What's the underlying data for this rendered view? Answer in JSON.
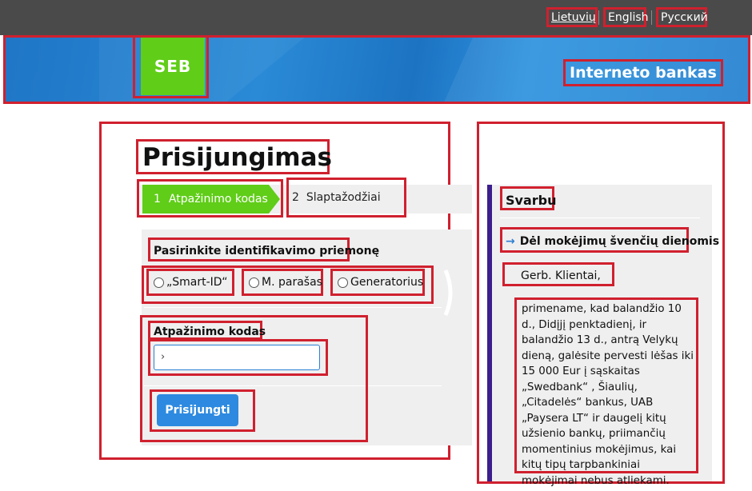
{
  "languages": [
    "Lietuvių",
    "English",
    "Русский"
  ],
  "brand": {
    "logo_text": "SEB",
    "logo_color": "#60cd18",
    "banner_title": "Interneto bankas"
  },
  "login": {
    "title": "Prisijungimas",
    "steps": [
      {
        "number": "1",
        "label": "Atpažinimo kodas",
        "active": true
      },
      {
        "number": "2",
        "label": "Slaptažodžiai",
        "active": false
      }
    ],
    "method_label": "Pasirinkite identifikavimo priemonę",
    "methods": [
      "„Smart-ID“",
      "M. parašas",
      "Generatorius"
    ],
    "code_label": "Atpažinimo kodas",
    "code_value": "›",
    "submit_label": "Prisijungti"
  },
  "notice": {
    "title": "Svarbu",
    "link": "Dėl mokėjimų švenčių dienomis",
    "greeting": "Gerb. Klientai,",
    "body": "primename, kad balandžio 10 d., Didįjį penktadienį, ir balandžio 13 d., antrą Velykų dieną, galėsite pervesti lėšas iki 15 000 Eur į sąskaitas „Swedbank“ , Šiaulių, „Citadelės“ bankus, UAB „Paysera LT“ ir daugelį kitų užsienio bankų, priimančių momentinius mokėjimus, kai kitų tipų tarpbankiniai mokėjimai nebus atliekami."
  },
  "colors": {
    "accent_green": "#60cd18",
    "button_blue": "#2d8ae0",
    "annotation_red": "#d0202e",
    "notice_bar": "#3c1e8c"
  },
  "icons": {
    "link_arrow": "arrow-right-icon",
    "next_chevron": "chevron-right-icon"
  }
}
